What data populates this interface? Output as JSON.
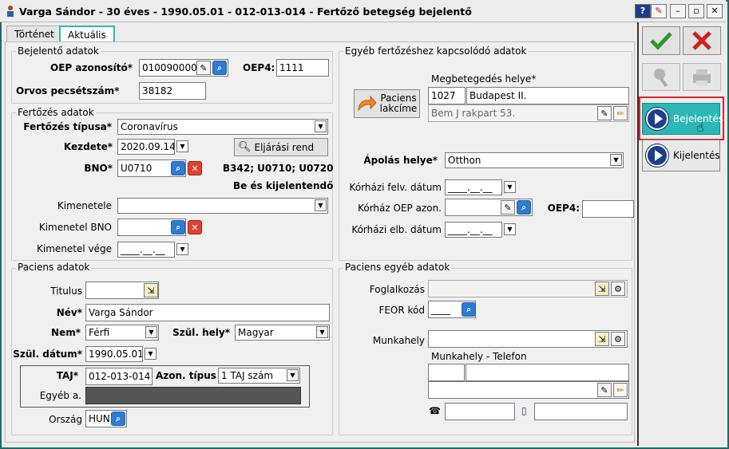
{
  "window": {
    "title": "Varga Sándor - 30 éves - 1990.05.01 - 012-013-014 - Fertőző betegség bejelentő"
  },
  "tabs": [
    {
      "label": "Történet"
    },
    {
      "label": "Aktuális"
    }
  ],
  "bejelento": {
    "title": "Bejelentő adatok",
    "oep_label": "OEP azonosító*",
    "oep_value": "010090000",
    "oep4_label": "OEP4:",
    "oep4_value": "1111",
    "pecset_label": "Orvos pecsétszám*",
    "pecset_value": "38182"
  },
  "fertozes": {
    "title": "Fertőzés adatok",
    "tipus_label": "Fertőzés típusa*",
    "tipus_value": "Coronavírus",
    "kezdete_label": "Kezdete*",
    "kezdete_value": "2020.09.14",
    "eljarasi_label": "Eljárási rend",
    "bno_label": "BNO*",
    "bno_value": "U0710",
    "bno_codes": "B342; U0710; U0720",
    "be_ki": "Be és kijelentendő",
    "kimenetele_label": "Kimenetele",
    "kimenetele_value": "",
    "kim_bno_label": "Kimenetel BNO",
    "kim_bno_value": "",
    "kim_vege_label": "Kimenetel vége",
    "kim_vege_value": "____.__.__"
  },
  "egyeb_fert": {
    "title": "Egyéb fertőzéshez kapcsolódó adatok",
    "paciens_lakcime": "Paciens lakcíme",
    "megbeteg_label": "Megbetegedés helye*",
    "irsz": "1027",
    "varos": "Budapest II.",
    "cim": "Bem J rakpart 53.",
    "apolas_label": "Ápolás helye*",
    "apolas_value": "Otthon",
    "felv_label": "Kórházi felv. dátum",
    "felv_value": "____.__.__",
    "korhaz_oep_label": "Kórház OEP azon.",
    "korhaz_oep_value": "",
    "oep4_label": "OEP4:",
    "oep4_value": "",
    "elb_label": "Kórházi elb. dátum",
    "elb_value": "____.__.__"
  },
  "paciens": {
    "title": "Paciens adatok",
    "titulus_label": "Titulus",
    "titulus_value": "",
    "nev_label": "Név*",
    "nev_value": "Varga Sándor",
    "nem_label": "Nem*",
    "nem_value": "Férfi",
    "szul_hely_label": "Szül. hely*",
    "szul_hely_value": "Magyar",
    "szul_datum_label": "Szül. dátum*",
    "szul_datum_value": "1990.05.01",
    "taj_label": "TAJ*",
    "taj_value": "012-013-014",
    "azon_tipus_label": "Azon. típus",
    "azon_tipus_value": "1 TAJ szám",
    "egyeb_a_label": "Egyéb a.",
    "orszag_label": "Ország",
    "orszag_value": "HUN"
  },
  "paciens_egyeb": {
    "title": "Paciens egyéb adatok",
    "foglalkozas_label": "Foglalkozás",
    "feor_label": "FEOR kód",
    "feor_value": "____",
    "munkahely_label": "Munkahely",
    "munkahely_tel_label": "Munkahely - Telefon"
  },
  "sidebar": {
    "bejelentes": "Bejelentés",
    "kijelentes": "Kijelentés"
  },
  "colors": {
    "accent": "#2bb7b5",
    "highlight_border": "#e0202a",
    "ok_green": "#2a9a2a",
    "cancel_red": "#d02020"
  }
}
